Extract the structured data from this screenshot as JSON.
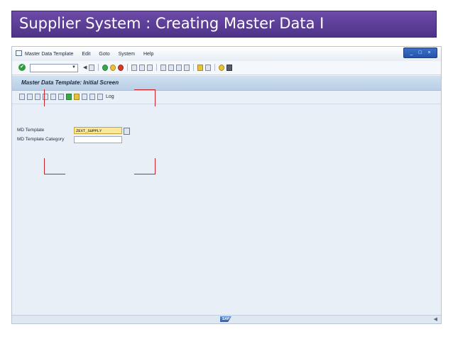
{
  "slide": {
    "title": "Supplier System : Creating Master Data I"
  },
  "menubar": {
    "items": [
      {
        "label": "Master Data Template"
      },
      {
        "label": "Edit"
      },
      {
        "label": "Goto"
      },
      {
        "label": "System"
      },
      {
        "label": "Help"
      }
    ],
    "window_controls": [
      "_",
      "□",
      "×"
    ]
  },
  "toolbar": {
    "command_field": {
      "value": ""
    }
  },
  "screen": {
    "title": "Master Data Template: Initial Screen",
    "app_toolbar": {
      "log_label": "Log"
    }
  },
  "form": {
    "fields": [
      {
        "label": "MD Template",
        "value": "ZEXT_SUPPLY",
        "focused": true
      },
      {
        "label": "MD Template Category",
        "value": ""
      }
    ]
  },
  "statusbar": {
    "logo": "SAP"
  },
  "colors": {
    "slide_header": "#5a3c97",
    "highlight_marks": "#c8242b"
  }
}
